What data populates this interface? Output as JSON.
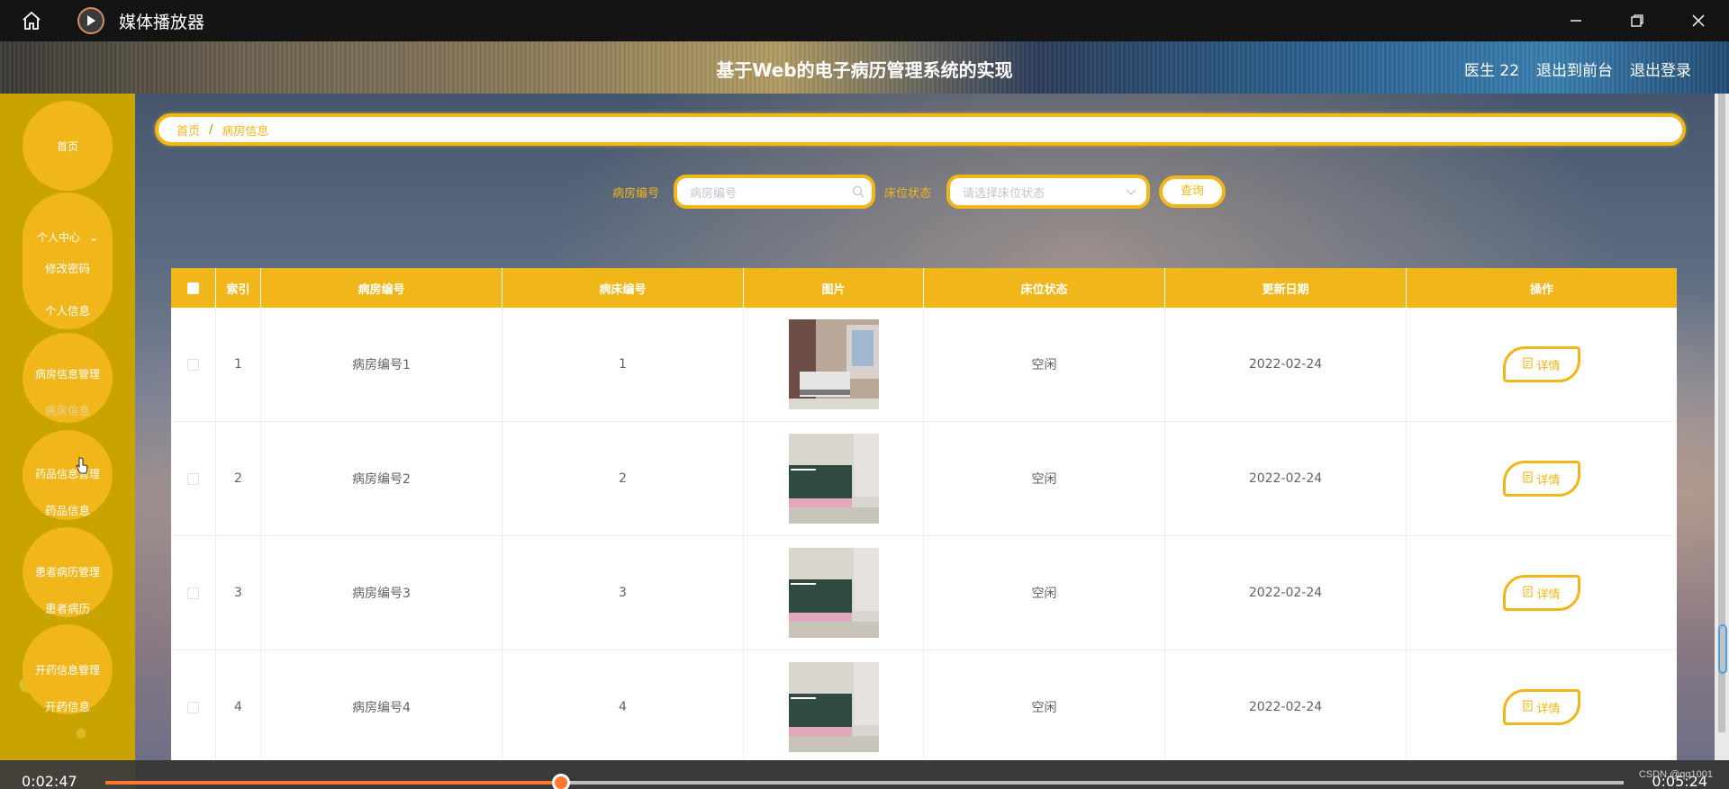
{
  "player": {
    "app_name": "媒体播放器",
    "current_time": "0:02:47",
    "total_time": "0:05:24",
    "progress": 0.3,
    "watermark": "CSDN @qq1001"
  },
  "header": {
    "title": "基于Web的电子病历管理系统的实现",
    "user": "医生 22",
    "front_link": "退出到前台",
    "logout_link": "退出登录"
  },
  "sidebar": {
    "items": [
      {
        "label": "首页",
        "subs": []
      },
      {
        "label": "个人中心",
        "subs": [
          "修改密码",
          "个人信息"
        ]
      },
      {
        "label": "病房信息管理",
        "subs": [
          "病房信息"
        ]
      },
      {
        "label": "药品信息管理",
        "subs": [
          "药品信息"
        ]
      },
      {
        "label": "患者病历管理",
        "subs": [
          "患者病历"
        ]
      },
      {
        "label": "开药信息管理",
        "subs": [
          "开药信息"
        ]
      }
    ]
  },
  "breadcrumb": {
    "home": "首页",
    "separator": "/",
    "current": "病房信息"
  },
  "search": {
    "room_label": "病房编号",
    "room_placeholder": "病房编号",
    "status_label": "床位状态",
    "status_placeholder": "请选择床位状态",
    "query_button": "查询"
  },
  "table": {
    "columns": [
      "索引",
      "病房编号",
      "病床编号",
      "图片",
      "床位状态",
      "更新日期",
      "操作"
    ],
    "rows": [
      {
        "index": "1",
        "room": "病房编号1",
        "bed": "1",
        "status": "空闲",
        "date": "2022-02-24",
        "action": "详情"
      },
      {
        "index": "2",
        "room": "病房编号2",
        "bed": "2",
        "status": "空闲",
        "date": "2022-02-24",
        "action": "详情"
      },
      {
        "index": "3",
        "room": "病房编号3",
        "bed": "3",
        "status": "空闲",
        "date": "2022-02-24",
        "action": "详情"
      },
      {
        "index": "4",
        "room": "病房编号4",
        "bed": "4",
        "status": "空闲",
        "date": "2022-02-24",
        "action": "详情"
      }
    ]
  },
  "colors": {
    "accent": "#f0b61a",
    "sidebar": "#c9a400",
    "progress": "#ff7a2e"
  }
}
